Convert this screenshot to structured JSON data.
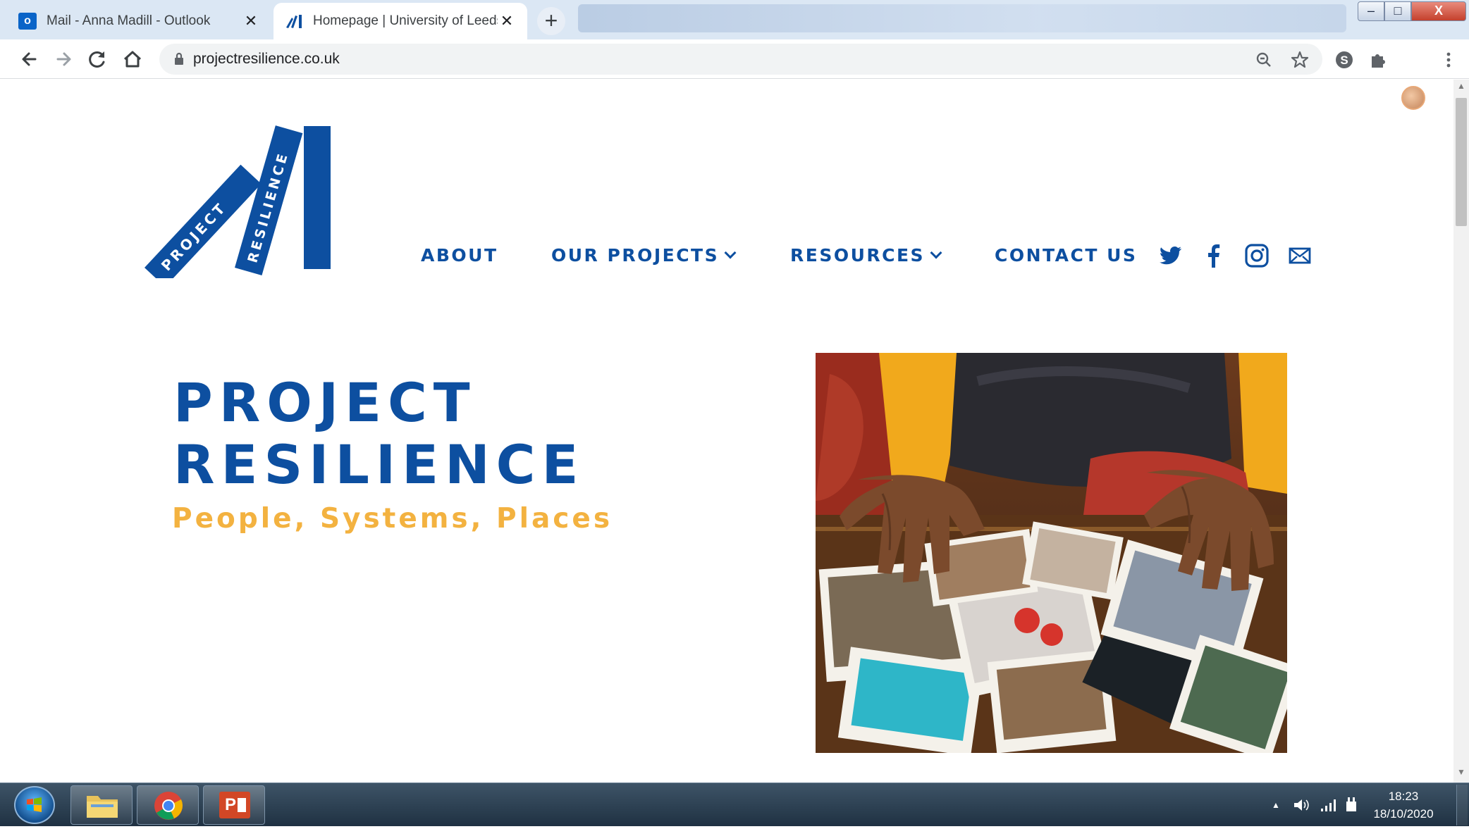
{
  "browser": {
    "tabs": [
      {
        "title": "Mail - Anna Madill - Outlook",
        "active": false
      },
      {
        "title": "Homepage | University of Leeds",
        "active": true
      }
    ],
    "new_tab_label": "+",
    "close_glyph": "✕",
    "window_controls": {
      "minimize": "–",
      "maximize": "□",
      "close": "X"
    },
    "nav_icons": [
      "back-arrow-icon",
      "forward-arrow-icon",
      "reload-icon",
      "home-icon"
    ],
    "url": "projectresilience.co.uk",
    "omnibox_icons": [
      "zoom-icon",
      "star-icon"
    ],
    "extension_icons": [
      "skype-icon",
      "puzzle-icon",
      "profile-avatar",
      "kebab-menu-icon"
    ]
  },
  "site": {
    "logo": {
      "word1": "PROJECT",
      "word2": "RESILIENCE",
      "color": "#0d4fa0"
    },
    "nav": {
      "about": "ABOUT",
      "projects": "OUR PROJECTS",
      "resources": "RESOURCES",
      "contact": "CONTACT US"
    },
    "social_icons": [
      "twitter-icon",
      "facebook-icon",
      "instagram-icon",
      "mail-icon"
    ],
    "hero": {
      "title_line1": "PROJECT",
      "title_line2": "RESILIENCE",
      "subtitle": "People, Systems, Places"
    },
    "colors": {
      "brand_blue": "#0d4fa0",
      "accent_yellow": "#f3b240"
    }
  },
  "taskbar": {
    "pinned": [
      "start-button",
      "file-explorer",
      "chrome",
      "powerpoint"
    ],
    "powerpoint_label": "P",
    "clock": {
      "time": "18:23",
      "date": "18/10/2020"
    }
  }
}
